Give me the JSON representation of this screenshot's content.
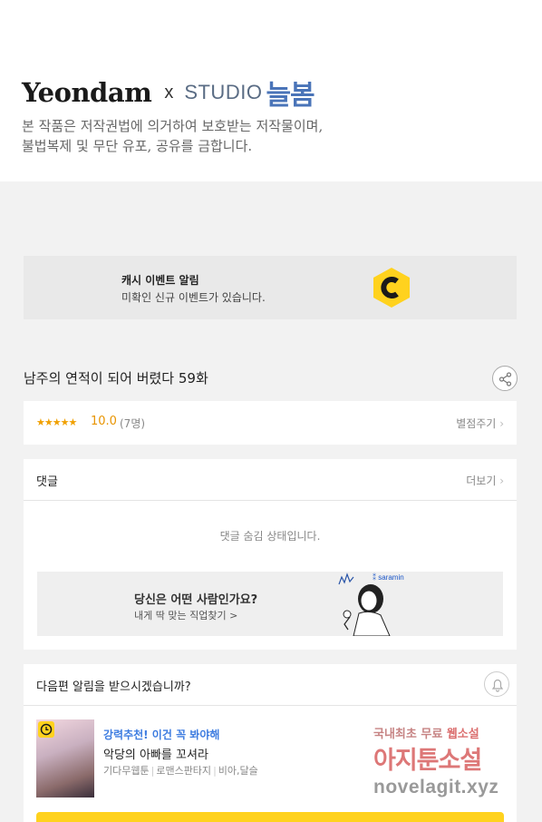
{
  "header": {
    "logo_yeondam": "Yeondam",
    "logo_x": "x",
    "logo_studio": "STUDIO",
    "logo_nulbom": "늘봄",
    "copyright_line1": "본 작품은 저작권법에 의거하여 보호받는 저작물이며,",
    "copyright_line2": "불법복제 및 무단 유포, 공유를 금합니다."
  },
  "event_banner": {
    "title": "캐시 이벤트 알림",
    "subtitle": "미확인 신규 이벤트가 있습니다.",
    "icon": "cash-c-hexagon-icon",
    "accent_color": "#ffd21e"
  },
  "episode": {
    "title": "남주의 연적이 되어 버렸다 59화",
    "share_icon": "share-icon"
  },
  "rating": {
    "stars": "★★★★★",
    "score": "10.0",
    "count": "(7명)",
    "rate_link": "별점주기",
    "star_color": "#f0a000"
  },
  "comments": {
    "title": "댓글",
    "more_link": "더보기",
    "hidden_message": "댓글 숨김 상태입니다.",
    "ad": {
      "title": "당신은 어떤 사람인가요?",
      "subtitle": "내게 딱 맞는 직업찾기 >",
      "brand": "saramin"
    }
  },
  "next_episode": {
    "title": "다음편 알림을 받으시겠습니까?",
    "bell_icon": "bell-icon",
    "recommendation": {
      "label": "강력추천! 이건 꼭 봐야해",
      "title": "악당의 아빠를 꼬셔라",
      "tags": [
        "기다무웹툰",
        "로맨스판타지",
        "비아,달슬"
      ]
    }
  },
  "watermark": {
    "line1_prefix": "국내최초 무료 ",
    "line1_highlight": "웹소설",
    "line2": "아지툰소설",
    "line3": "novelagit.xyz"
  }
}
